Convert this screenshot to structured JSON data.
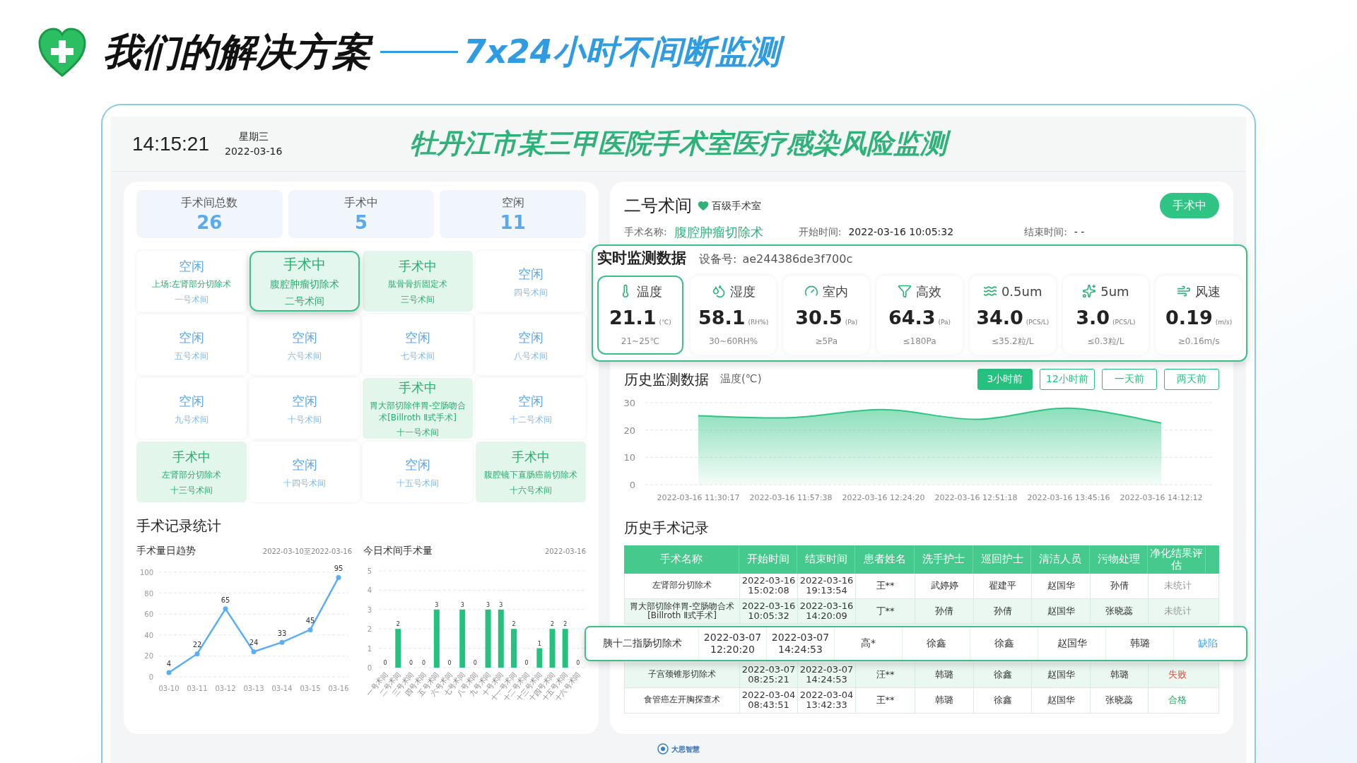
{
  "slide": {
    "title": "我们的解决方案",
    "subtitle": "7x24小时不间断监测"
  },
  "header": {
    "time": "14:15:21",
    "weekday": "星期三",
    "date": "2022-03-16",
    "title": "牡丹江市某三甲医院手术室医疗感染风险监测"
  },
  "stats": [
    {
      "label": "手术间总数",
      "value": "26"
    },
    {
      "label": "手术中",
      "value": "5"
    },
    {
      "label": "空闲",
      "value": "11"
    }
  ],
  "rooms": [
    {
      "kind": "idle",
      "status": "空闲",
      "surgery": "上场:左肾部分切除术",
      "name": "一号术间",
      "selected": false
    },
    {
      "kind": "busy",
      "status": "手术中",
      "surgery": "腹腔肿瘤切除术",
      "name": "二号术间",
      "selected": true
    },
    {
      "kind": "busy",
      "status": "手术中",
      "surgery": "肱骨骨折固定术",
      "name": "三号术间",
      "selected": false
    },
    {
      "kind": "idle",
      "status": "空闲",
      "name": "四号术间",
      "selected": false
    },
    {
      "kind": "idle",
      "status": "空闲",
      "name": "五号术间",
      "selected": false
    },
    {
      "kind": "idle",
      "status": "空闲",
      "name": "六号术间",
      "selected": false
    },
    {
      "kind": "idle",
      "status": "空闲",
      "name": "七号术间",
      "selected": false
    },
    {
      "kind": "idle",
      "status": "空闲",
      "name": "八号术间",
      "selected": false
    },
    {
      "kind": "idle",
      "status": "空闲",
      "name": "九号术间",
      "selected": false
    },
    {
      "kind": "idle",
      "status": "空闲",
      "name": "十号术间",
      "selected": false
    },
    {
      "kind": "busy",
      "status": "手术中",
      "surgery": "胃大部切除伴胃-空肠吻合术[Billroth Ⅱ式手术]",
      "name": "十一号术间",
      "selected": false
    },
    {
      "kind": "idle",
      "status": "空闲",
      "name": "十二号术间",
      "selected": false
    },
    {
      "kind": "busy",
      "status": "手术中",
      "surgery": "左肾部分切除术",
      "name": "十三号术间",
      "selected": false
    },
    {
      "kind": "idle",
      "status": "空闲",
      "name": "十四号术间",
      "selected": false
    },
    {
      "kind": "idle",
      "status": "空闲",
      "name": "十五号术间",
      "selected": false
    },
    {
      "kind": "busy",
      "status": "手术中",
      "surgery": "腹腔镜下直肠癌前切除术",
      "name": "十六号术间",
      "selected": false
    }
  ],
  "records": {
    "title": "手术记录统计",
    "trend": {
      "title": "手术量日趋势",
      "range": "2022-03-10至2022-03-16",
      "chart_data": {
        "type": "line",
        "categories": [
          "03-10",
          "03-11",
          "03-12",
          "03-13",
          "03-14",
          "03-15",
          "03-16"
        ],
        "series": [
          {
            "color": "#5aaef5",
            "marker": "circle",
            "values": [
              4,
              22,
              65,
              24,
              33,
              45,
              95
            ]
          }
        ],
        "ylim": [
          0,
          100
        ],
        "yticks": [
          0,
          20,
          40,
          60,
          80,
          100
        ],
        "grid": true,
        "data_labels": true
      }
    },
    "today": {
      "title": "今日术间手术量",
      "date": "2022-03-16",
      "chart_data": {
        "type": "bar",
        "categories": [
          "一号术间",
          "二号术间",
          "三号术间",
          "四号术间",
          "五号术间",
          "六号术间",
          "七号术间",
          "八号术间",
          "九号术间",
          "十号术间",
          "十一号术间",
          "十二号术间",
          "十三号术间",
          "十四号术间",
          "十五号术间",
          "十六号术间"
        ],
        "series": [
          {
            "color": "#25c17f",
            "values": [
              0,
              2,
              0,
              0,
              3,
              0,
              3,
              0,
              3,
              3,
              2,
              0,
              1,
              2,
              2,
              0
            ]
          }
        ],
        "ylim": [
          0,
          5
        ],
        "yticks": [
          0,
          1,
          2,
          3,
          4,
          5
        ],
        "grid": true,
        "data_labels": true
      }
    }
  },
  "room_detail": {
    "name": "二号术间",
    "grade": "百级手术室",
    "status": "手术中",
    "surgery_label": "手术名称:",
    "surgery": "腹腔肿瘤切除术",
    "start_label": "开始时间:",
    "start": "2022-03-16 10:05:32",
    "end_label": "结束时间:",
    "end": "- -"
  },
  "realtime": {
    "title": "实时监测数据",
    "device_label": "设备号:",
    "device": "ae244386de3f700c",
    "metrics": [
      {
        "kind": "temperature",
        "label": "温度",
        "value": "21.1",
        "unit": "(℃)",
        "range": "21~25℃",
        "selected": true
      },
      {
        "kind": "humidity",
        "label": "湿度",
        "value": "58.1",
        "unit": "(RH%)",
        "range": "30~60RH%",
        "selected": false
      },
      {
        "kind": "pressure",
        "label": "室内",
        "value": "30.5",
        "unit": "(Pa)",
        "range": "≥5Pa",
        "selected": false
      },
      {
        "kind": "hepa",
        "label": "高效",
        "value": "64.3",
        "unit": "(Pa)",
        "range": "≤180Pa",
        "selected": false
      },
      {
        "kind": "pm05",
        "label": "0.5um",
        "value": "34.0",
        "unit": "(PCS/L)",
        "range": "≤35.2粒/L",
        "selected": false
      },
      {
        "kind": "pm5",
        "label": "5um",
        "value": "3.0",
        "unit": "(PCS/L)",
        "range": "≤0.3粒/L",
        "selected": false
      },
      {
        "kind": "wind",
        "label": "风速",
        "value": "0.19",
        "unit": "(m/s)",
        "range": "≥0.16m/s",
        "selected": false
      }
    ]
  },
  "history": {
    "title": "历史监测数据",
    "metric": "温度(℃)",
    "ranges": [
      {
        "label": "3小时前",
        "selected": true
      },
      {
        "label": "12小时前",
        "selected": false
      },
      {
        "label": "一天前",
        "selected": false
      },
      {
        "label": "两天前",
        "selected": false
      }
    ],
    "chart_data": {
      "type": "area",
      "x": [
        "2022-03-16 11:30:17",
        "2022-03-16 11:57:38",
        "2022-03-16 12:24:20",
        "2022-03-16 12:51:18",
        "2022-03-16 13:45:16",
        "2022-03-16 14:12:12"
      ],
      "series": [
        {
          "color": "#2ec483",
          "values": [
            25.2,
            24.5,
            27.5,
            23.9,
            28,
            22.6
          ]
        }
      ],
      "ylim": [
        0,
        30
      ],
      "yticks": [
        0,
        10,
        20,
        30
      ],
      "grid": true
    }
  },
  "surgery_table": {
    "title": "历史手术记录",
    "columns": [
      "手术名称",
      "开始时间",
      "结束时间",
      "患者姓名",
      "洗手护士",
      "巡回护士",
      "清洁人员",
      "污物处理",
      "净化结果评估"
    ],
    "rows": [
      {
        "cells": [
          "左肾部分切除术",
          "2022-03-16 15:02:08",
          "2022-03-16 19:13:54",
          "王**",
          "武婷婷",
          "翟建平",
          "赵国华",
          "孙倩"
        ],
        "result": "未统计",
        "kind": "pending",
        "selected": false
      },
      {
        "cells": [
          "胃大部切除伴胃-空肠吻合术[Billroth Ⅱ式手术]",
          "2022-03-16 10:05:32",
          "2022-03-16 14:20:09",
          "丁**",
          "孙倩",
          "孙倩",
          "赵国华",
          "张晓蕊"
        ],
        "result": "未统计",
        "kind": "pending",
        "selected": false
      },
      {
        "cells": [
          "胰十二指肠切除术",
          "2022-03-07 12:20:20",
          "2022-03-07 14:24:53",
          "高*",
          "徐鑫",
          "徐鑫",
          "赵国华",
          "韩璐"
        ],
        "result": "缺陷",
        "kind": "defect",
        "selected": true
      },
      {
        "cells": [
          "子宫颈锥形切除术",
          "2022-03-07 08:25:21",
          "2022-03-07 14:24:53",
          "汪**",
          "韩璐",
          "徐鑫",
          "赵国华",
          "韩璐"
        ],
        "result": "失败",
        "kind": "fail",
        "selected": false
      },
      {
        "cells": [
          "食管癌左开胸探查术",
          "2022-03-04 08:43:51",
          "2022-03-04 13:42:33",
          "王**",
          "韩璐",
          "徐鑫",
          "赵国华",
          "张晓蕊"
        ],
        "result": "合格",
        "kind": "pass",
        "selected": false
      }
    ]
  },
  "footer": {
    "brand": "大思智慧"
  }
}
